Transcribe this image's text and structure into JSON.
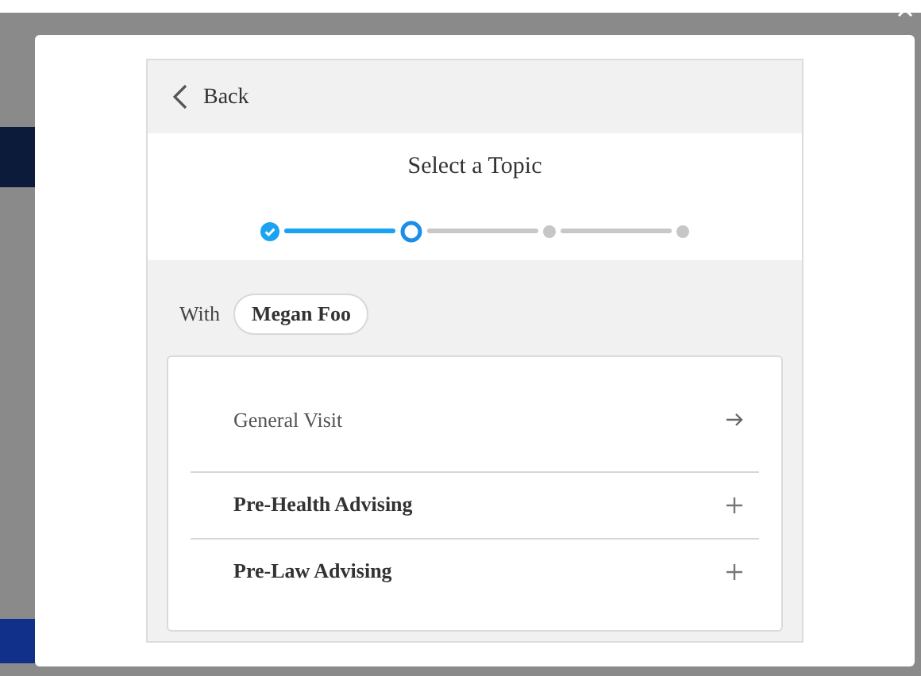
{
  "back": {
    "label": "Back"
  },
  "title": "Select a Topic",
  "steps": [
    {
      "completed": true,
      "selected": false
    },
    {
      "completed": false,
      "selected": true
    },
    {
      "completed": false,
      "selected": false
    },
    {
      "completed": false,
      "selected": false
    }
  ],
  "with": {
    "label": "With",
    "advisor": "Megan Foo"
  },
  "topics": [
    {
      "label": "General Visit",
      "kind": "link"
    },
    {
      "label": "Pre-Health Advising",
      "kind": "expand"
    },
    {
      "label": "Pre-Law Advising",
      "kind": "expand"
    }
  ]
}
